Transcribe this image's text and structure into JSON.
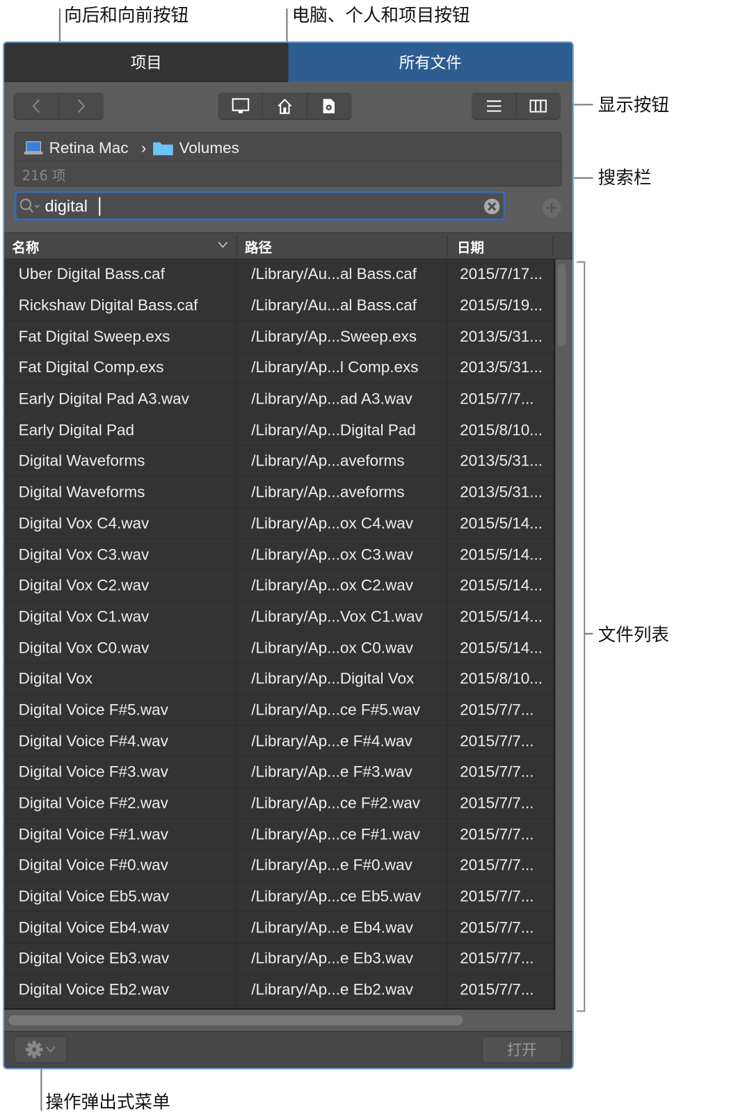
{
  "annotations": {
    "back_forward": "向后和向前按钮",
    "computer_personal_project": "电脑、个人和项目按钮",
    "display": "显示按钮",
    "search": "搜索栏",
    "file_list": "文件列表",
    "action_menu": "操作弹出式菜单"
  },
  "tabs": [
    {
      "label": "项目",
      "active": false
    },
    {
      "label": "所有文件",
      "active": true
    }
  ],
  "path": {
    "computer": "Retina Mac",
    "separator": "›",
    "folder": "Volumes",
    "count": "216 项"
  },
  "search": {
    "value": "digital"
  },
  "columns": {
    "name": "名称",
    "path": "路径",
    "date": "日期"
  },
  "files": [
    {
      "name": "Uber Digital Bass.caf",
      "path": "/Library/Au...al Bass.caf",
      "date": "2015/7/17..."
    },
    {
      "name": "Rickshaw Digital Bass.caf",
      "path": "/Library/Au...al Bass.caf",
      "date": "2015/5/19..."
    },
    {
      "name": "Fat Digital Sweep.exs",
      "path": "/Library/Ap...Sweep.exs",
      "date": "2013/5/31..."
    },
    {
      "name": "Fat Digital Comp.exs",
      "path": "/Library/Ap...l Comp.exs",
      "date": "2013/5/31..."
    },
    {
      "name": "Early Digital Pad A3.wav",
      "path": "/Library/Ap...ad A3.wav",
      "date": "2015/7/7..."
    },
    {
      "name": "Early Digital Pad",
      "path": "/Library/Ap...Digital Pad",
      "date": "2015/8/10..."
    },
    {
      "name": "Digital Waveforms",
      "path": "/Library/Ap...aveforms",
      "date": "2013/5/31..."
    },
    {
      "name": "Digital Waveforms",
      "path": "/Library/Ap...aveforms",
      "date": "2013/5/31..."
    },
    {
      "name": "Digital Vox C4.wav",
      "path": "/Library/Ap...ox C4.wav",
      "date": "2015/5/14..."
    },
    {
      "name": "Digital Vox C3.wav",
      "path": "/Library/Ap...ox C3.wav",
      "date": "2015/5/14..."
    },
    {
      "name": "Digital Vox C2.wav",
      "path": "/Library/Ap...ox C2.wav",
      "date": "2015/5/14..."
    },
    {
      "name": "Digital Vox C1.wav",
      "path": "/Library/Ap...Vox C1.wav",
      "date": "2015/5/14..."
    },
    {
      "name": "Digital Vox C0.wav",
      "path": "/Library/Ap...ox C0.wav",
      "date": "2015/5/14..."
    },
    {
      "name": "Digital Vox",
      "path": "/Library/Ap...Digital Vox",
      "date": "2015/8/10..."
    },
    {
      "name": "Digital Voice F#5.wav",
      "path": "/Library/Ap...ce F#5.wav",
      "date": "2015/7/7..."
    },
    {
      "name": "Digital Voice F#4.wav",
      "path": "/Library/Ap...e F#4.wav",
      "date": "2015/7/7..."
    },
    {
      "name": "Digital Voice F#3.wav",
      "path": "/Library/Ap...e F#3.wav",
      "date": "2015/7/7..."
    },
    {
      "name": "Digital Voice F#2.wav",
      "path": "/Library/Ap...ce F#2.wav",
      "date": "2015/7/7..."
    },
    {
      "name": "Digital Voice F#1.wav",
      "path": "/Library/Ap...ce F#1.wav",
      "date": "2015/7/7..."
    },
    {
      "name": "Digital Voice F#0.wav",
      "path": "/Library/Ap...e F#0.wav",
      "date": "2015/7/7..."
    },
    {
      "name": "Digital Voice Eb5.wav",
      "path": "/Library/Ap...ce Eb5.wav",
      "date": "2015/7/7..."
    },
    {
      "name": "Digital Voice Eb4.wav",
      "path": "/Library/Ap...e Eb4.wav",
      "date": "2015/7/7..."
    },
    {
      "name": "Digital Voice Eb3.wav",
      "path": "/Library/Ap...e Eb3.wav",
      "date": "2015/7/7..."
    },
    {
      "name": "Digital Voice Eb2.wav",
      "path": "/Library/Ap...e Eb2.wav",
      "date": "2015/7/7..."
    }
  ],
  "footer": {
    "open_label": "打开"
  },
  "colors": {
    "accent": "#2e5d91",
    "focus": "#3a68b8",
    "window_border": "#6aa6ea"
  }
}
